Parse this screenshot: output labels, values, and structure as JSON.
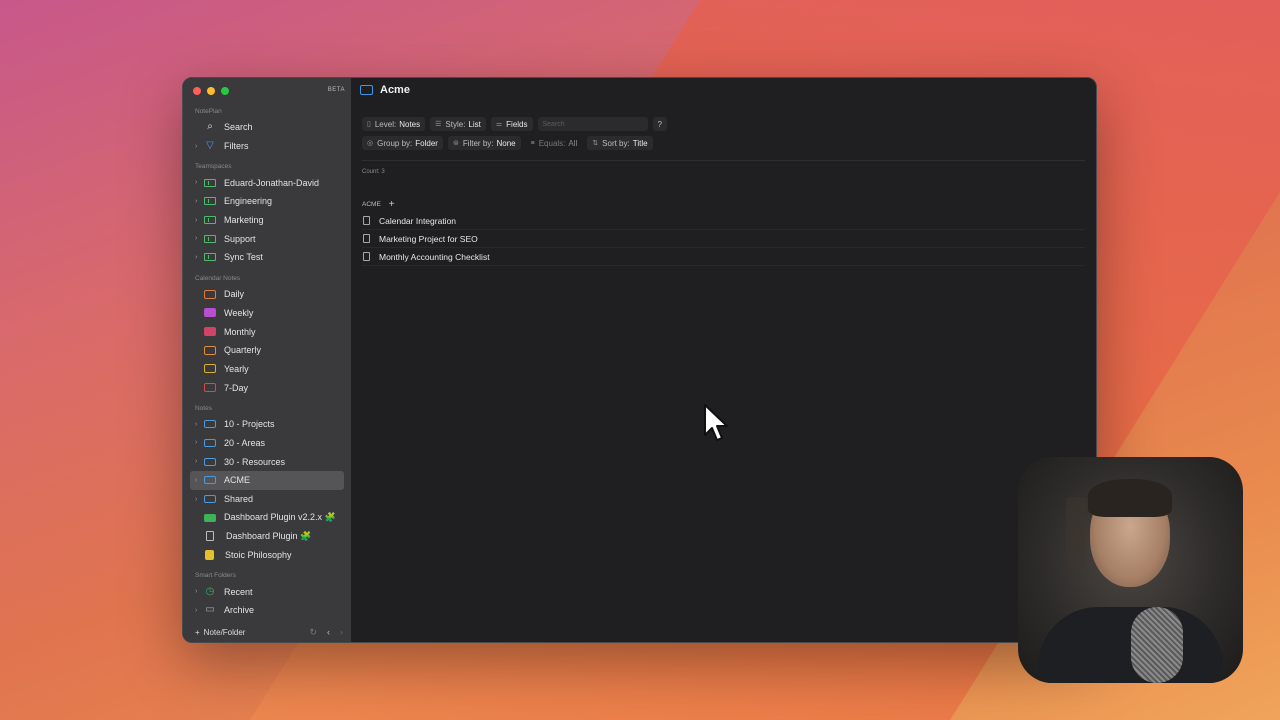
{
  "app": {
    "badge": "BETA",
    "traffic_colors": {
      "close": "#fe5f57",
      "minimize": "#febc2e",
      "zoom": "#28c840"
    }
  },
  "sidebar": {
    "sections": {
      "app_name": "NotePlan",
      "teamspaces": "Teamspaces",
      "calendar_notes": "Calendar Notes",
      "notes": "Notes",
      "smart_folders": "Smart Folders"
    },
    "top_items": [
      {
        "label": "Search",
        "icon": "search-icon"
      },
      {
        "label": "Filters",
        "icon": "filter-icon"
      }
    ],
    "teamspaces": [
      {
        "label": "Eduard-Jonathan-David"
      },
      {
        "label": "Engineering"
      },
      {
        "label": "Marketing"
      },
      {
        "label": "Support"
      },
      {
        "label": "Sync Test"
      }
    ],
    "calendar": [
      {
        "label": "Daily",
        "color": "#e07a3a"
      },
      {
        "label": "Weekly",
        "color": "#b84fd0"
      },
      {
        "label": "Monthly",
        "color": "#d0446a"
      },
      {
        "label": "Quarterly",
        "color": "#e08a3a"
      },
      {
        "label": "Yearly",
        "color": "#d8b02a"
      },
      {
        "label": "7-Day",
        "color": "#d84a4a"
      }
    ],
    "notes": [
      {
        "label": "10 - Projects"
      },
      {
        "label": "20 - Areas"
      },
      {
        "label": "30 - Resources"
      },
      {
        "label": "ACME"
      },
      {
        "label": "Shared"
      },
      {
        "label": "Dashboard Plugin v2.2.x 🧩"
      },
      {
        "label": "Dashboard Plugin 🧩"
      },
      {
        "label": "Stoic Philosophy"
      }
    ],
    "smart_folders": [
      {
        "label": "Recent"
      },
      {
        "label": "Archive"
      }
    ],
    "bottom": {
      "new_label": "Note/Folder"
    }
  },
  "main": {
    "title": "Acme",
    "toolbar1": {
      "level_label": "Level:",
      "level_value": "Notes",
      "style_label": "Style:",
      "style_value": "List",
      "fields_label": "Fields",
      "search_placeholder": "Search",
      "help_label": "?"
    },
    "toolbar2": {
      "group_label": "Group by:",
      "group_value": "Folder",
      "filter_label": "Filter by:",
      "filter_value": "None",
      "equals_label": "Equals:",
      "equals_value": "All",
      "sort_label": "Sort by:",
      "sort_value": "Title"
    },
    "count": "Count: 3",
    "group_name": "ACME",
    "notes": [
      "Calendar Integration",
      "Marketing Project for SEO",
      "Monthly Accounting Checklist"
    ]
  }
}
